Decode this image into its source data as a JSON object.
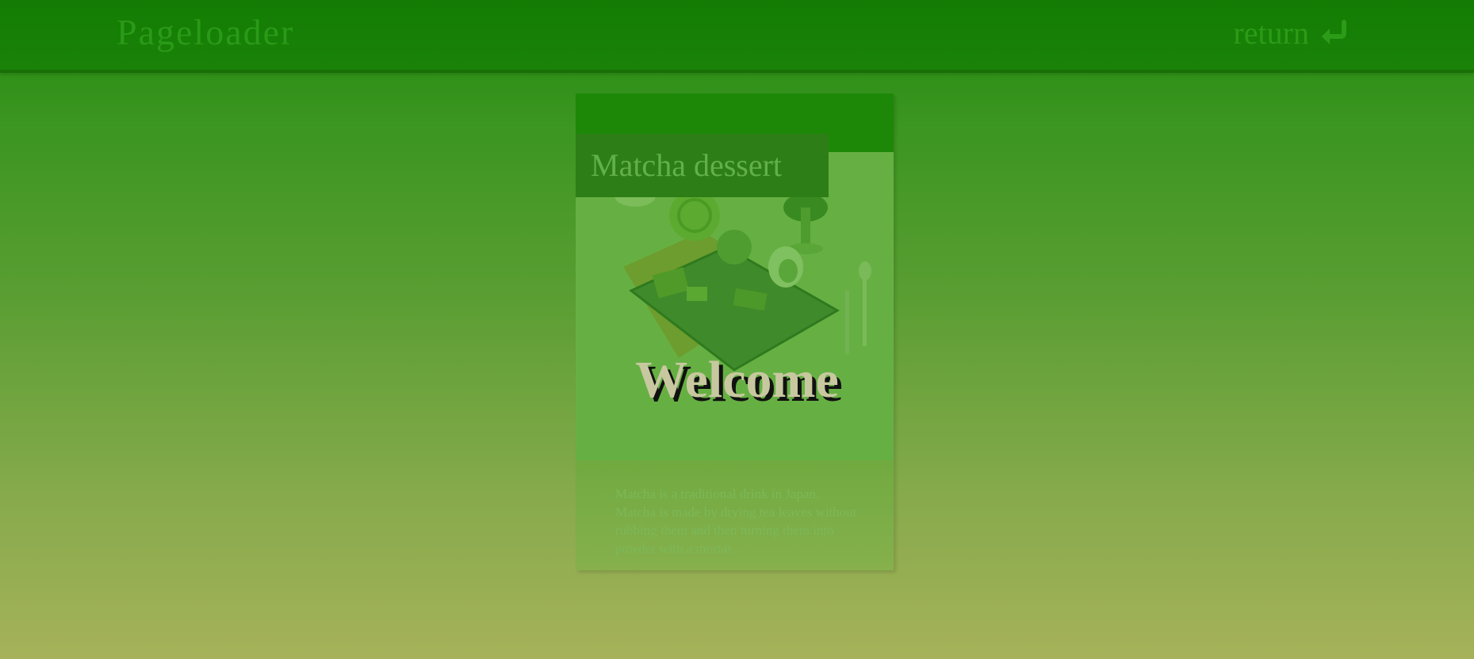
{
  "header": {
    "brand": "Pageloader",
    "return_label": "return",
    "return_icon": "return-arrow-icon"
  },
  "card": {
    "title": "Matcha dessert",
    "image_alt": "matcha-dessert-photo",
    "description": "Matcha is a traditional drink in Japan. Matcha is made by drying tea leaves without rubbing them and then turning them into powder with a mortar"
  },
  "overlay": {
    "welcome": "Welcome"
  },
  "colors": {
    "topbar": "#137c03",
    "accent": "#2a9a18",
    "background_bottom": "#a6b259"
  }
}
